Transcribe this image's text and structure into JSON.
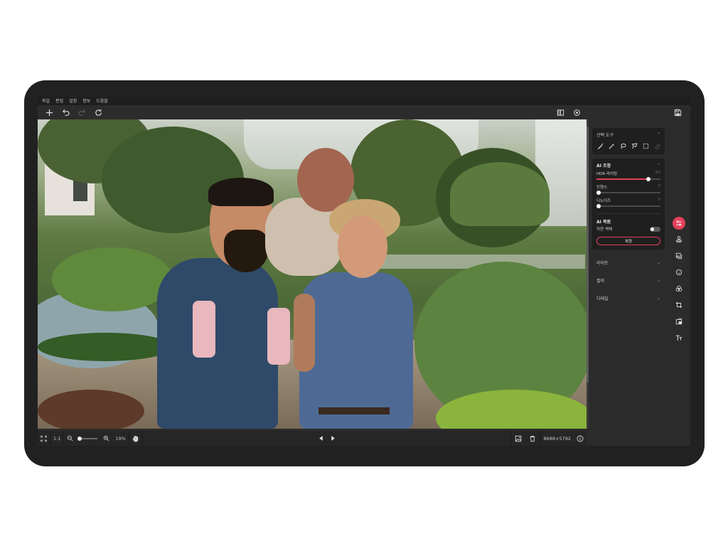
{
  "menu": [
    "파일",
    "편집",
    "설정",
    "정보",
    "도움말"
  ],
  "toolbar": {
    "left_icons": [
      "add-icon",
      "undo-icon",
      "redo-icon",
      "reset-icon"
    ],
    "right_icons": [
      "compare-icon",
      "preview-icon",
      "save-icon"
    ]
  },
  "selection_tools": {
    "title": "선택 도구",
    "tools": [
      "brush-icon",
      "magic-wand-icon",
      "lasso-icon",
      "polygon-lasso-icon",
      "marquee-icon",
      "eraser-icon"
    ]
  },
  "ai_adjust": {
    "title": "AI 조정",
    "sliders": [
      {
        "label": "HDR 라이팅",
        "value": "81",
        "percent": 81
      },
      {
        "label": "인핸스",
        "value": "0",
        "percent": 0
      },
      {
        "label": "디노이즈",
        "value": "0",
        "percent": 0
      }
    ]
  },
  "ai_restore": {
    "title": "AI 복원",
    "toggle_label": "자연 색채",
    "toggle_on": false,
    "button": "복원"
  },
  "sections": [
    "라이트",
    "컬러",
    "디테일"
  ],
  "rail_icons": [
    "adjust-icon",
    "stamp-icon",
    "layers-icon",
    "face-icon",
    "color-mix-icon",
    "crop-icon",
    "resize-icon",
    "text-icon"
  ],
  "bottom": {
    "fit_icon": "fit-screen-icon",
    "one_to_one": "1:1",
    "zoom": "19%",
    "image_size": "8688×5792"
  },
  "colors": {
    "accent": "#e3405a",
    "panel": "#1f1f1f",
    "background": "#2b2b2b"
  }
}
